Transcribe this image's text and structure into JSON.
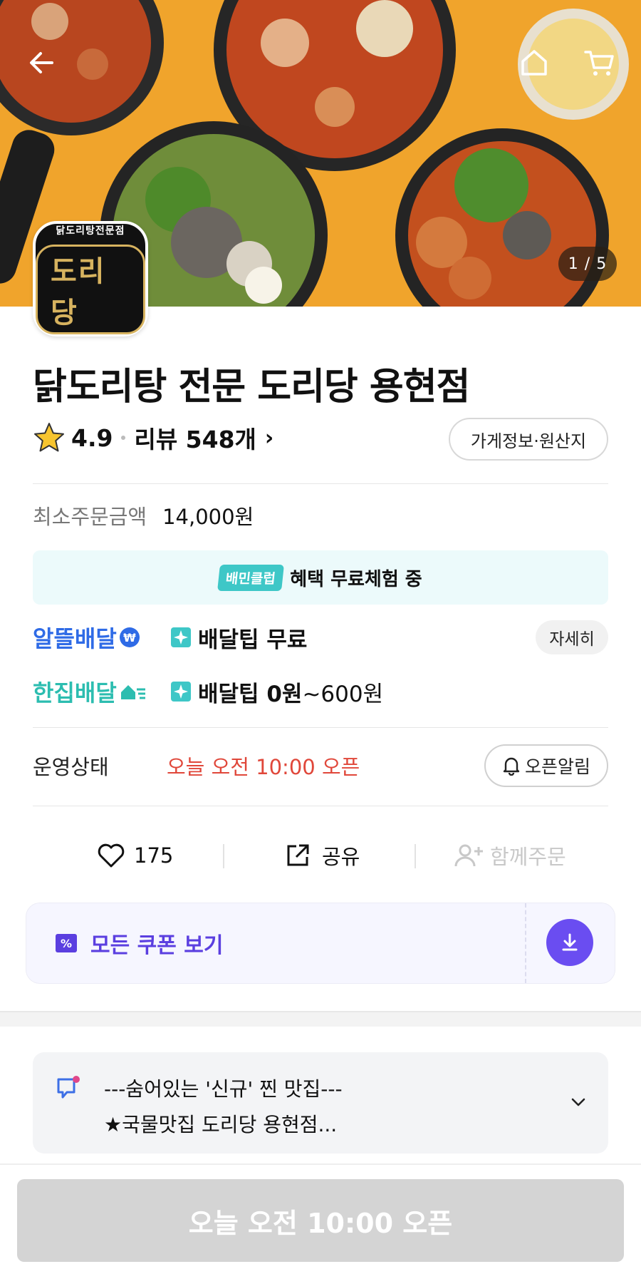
{
  "hero": {
    "counter": "1 / 5",
    "icons": [
      "back-arrow-icon",
      "home-icon",
      "cart-icon"
    ]
  },
  "logo": {
    "sub": "닭도리탕전문점",
    "main": "도리당"
  },
  "store": {
    "title": "닭도리탕 전문 도리당 용현점",
    "rating": "4.9",
    "review": "리뷰 548개",
    "info_button": "가게정보·원산지"
  },
  "min_order": {
    "label": "최소주문금액",
    "value": "14,000원"
  },
  "club": {
    "badge": "배민클럽",
    "text": "혜택 무료체험 중"
  },
  "delivery": [
    {
      "brand": "알뜰배달",
      "tip": "배달팁 무료",
      "tip_extra": ""
    },
    {
      "brand": "한집배달",
      "tip": "배달팁 0원",
      "tip_extra": "~600원"
    }
  ],
  "detail_button": "자세히",
  "status": {
    "label": "운영상태",
    "value": "오늘 오전 10:00 오픈",
    "alarm_button": "오픈알림"
  },
  "actions": {
    "likes": "175",
    "share": "공유",
    "group": "함께주문"
  },
  "coupon": {
    "label": "모든 쿠폰 보기"
  },
  "notice": {
    "line1": "---숨어있는 '신규' 찐 맛집---",
    "line2": "★국물맛집 도리당 용현점..."
  },
  "cta": "오늘 오전 10:00 오픈",
  "colors": {
    "accent_purple": "#6a4df1",
    "status_red": "#e0473a",
    "brand_blue": "#2f6be6",
    "brand_teal": "#2cbdb0"
  }
}
